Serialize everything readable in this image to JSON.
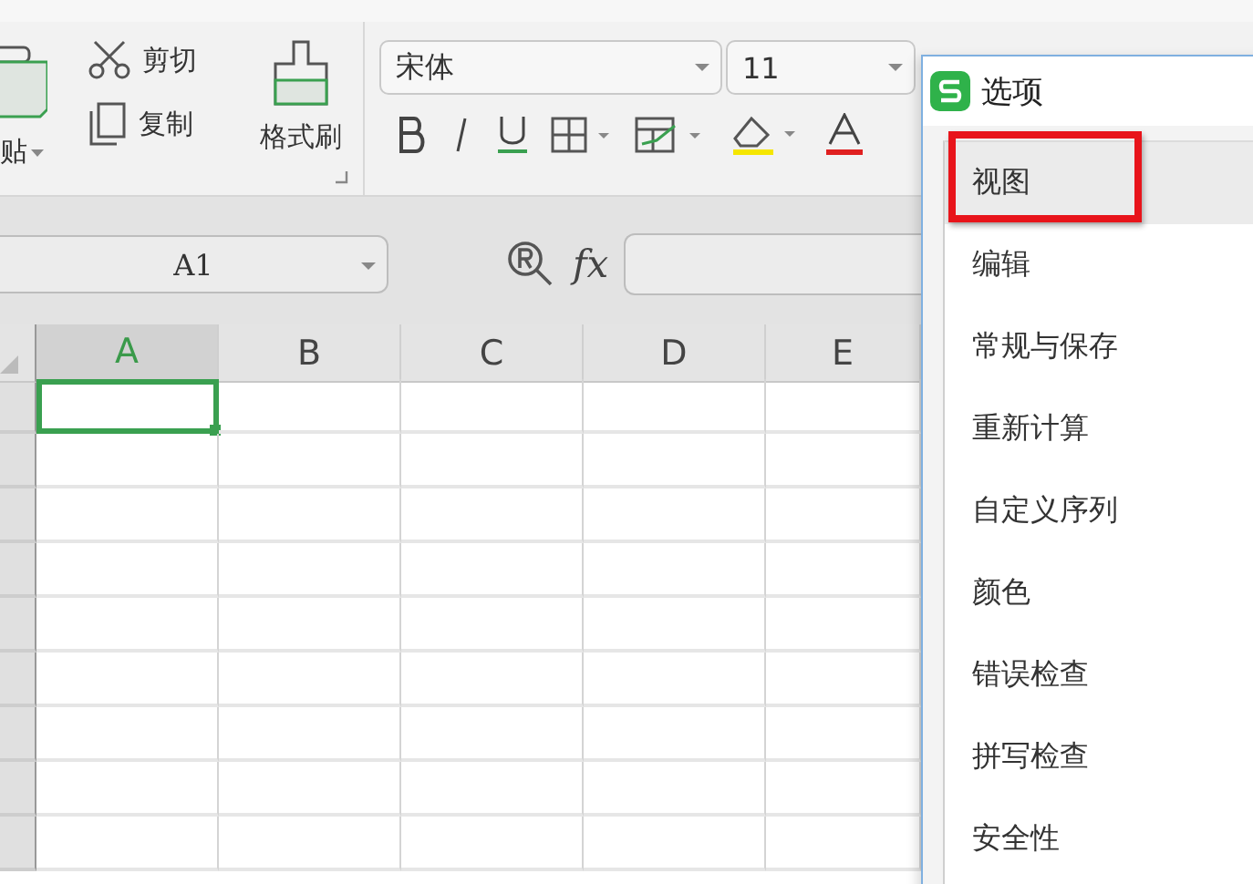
{
  "ribbon": {
    "clipboard": {
      "paste_label": "贴",
      "cut_label": "剪切",
      "copy_label": "复制",
      "format_painter_label": "格式刷"
    },
    "font": {
      "name": "宋体",
      "size": "11"
    }
  },
  "formula_bar": {
    "name_box": "A1",
    "fx_label": "fx"
  },
  "sheet": {
    "columns": [
      {
        "label": "A",
        "selected": true
      },
      {
        "label": "B",
        "selected": false
      },
      {
        "label": "C",
        "selected": false
      },
      {
        "label": "D",
        "selected": false
      },
      {
        "label": "E",
        "selected": false
      }
    ]
  },
  "dialog": {
    "title": "选项",
    "items": [
      {
        "label": "视图",
        "selected": true,
        "outlined": true
      },
      {
        "label": "编辑",
        "selected": false,
        "outlined": false
      },
      {
        "label": "常规与保存",
        "selected": false,
        "outlined": false
      },
      {
        "label": "重新计算",
        "selected": false,
        "outlined": false
      },
      {
        "label": "自定义序列",
        "selected": false,
        "outlined": false
      },
      {
        "label": "颜色",
        "selected": false,
        "outlined": false
      },
      {
        "label": "错误检查",
        "selected": false,
        "outlined": false
      },
      {
        "label": "拼写检查",
        "selected": false,
        "outlined": false
      },
      {
        "label": "安全性",
        "selected": false,
        "outlined": false
      }
    ]
  }
}
